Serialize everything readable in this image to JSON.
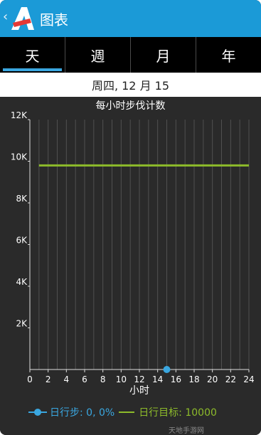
{
  "header": {
    "back_glyph": "‹",
    "title": "图表"
  },
  "tabs": [
    {
      "label": "天",
      "active": true
    },
    {
      "label": "週",
      "active": false
    },
    {
      "label": "月",
      "active": false
    },
    {
      "label": "年",
      "active": false
    }
  ],
  "date": "周四, 12 月 15",
  "watermark": "天地手游网",
  "colors": {
    "app_bar": "#1b9ad7",
    "steps": "#3aa7e0",
    "goal": "#8dbb2a"
  },
  "chart_data": {
    "type": "line",
    "title": "每小时步伐计数",
    "xlabel": "小时",
    "ylabel": "",
    "xlim": [
      0,
      24
    ],
    "ylim": [
      0,
      12000
    ],
    "x_ticks": [
      "0",
      "2",
      "4",
      "6",
      "8",
      "10",
      "12",
      "14",
      "16",
      "18",
      "20",
      "22",
      "24"
    ],
    "y_ticks": [
      "2K",
      "4K",
      "6K",
      "8K",
      "10K",
      "12K"
    ],
    "grid": "vertical",
    "series": [
      {
        "name": "日行步",
        "type": "scatter",
        "points": [
          {
            "x": 15,
            "y": 0
          }
        ]
      },
      {
        "name": "日行目标",
        "type": "line",
        "points": [
          {
            "x": 1,
            "y": 9800
          },
          {
            "x": 24,
            "y": 9800
          }
        ]
      }
    ],
    "legend": {
      "steps_label": "日行步: 0, 0%",
      "goal_label": "日行目标: 10000"
    }
  }
}
